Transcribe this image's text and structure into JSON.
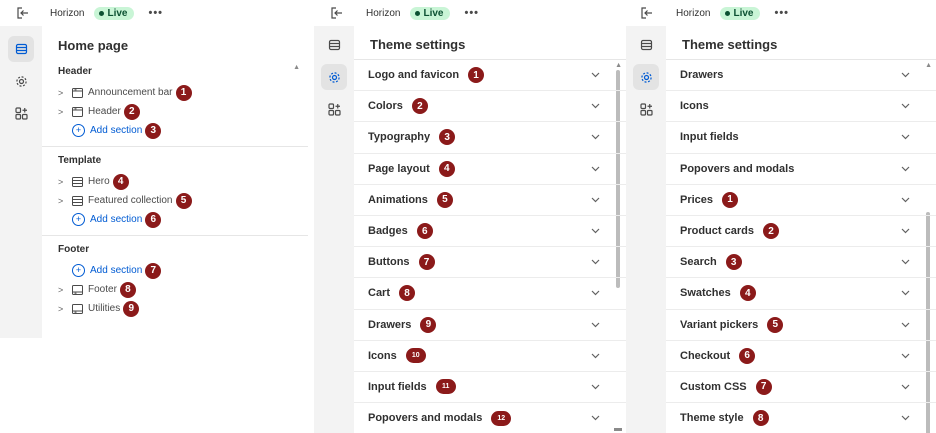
{
  "colors": {
    "live_bg": "#c9f5d6",
    "live_text": "#0c5132",
    "badge": "#8b1a1a",
    "link": "#005bd3"
  },
  "topbar": {
    "app_name": "Horizon",
    "status": "Live",
    "more": "•••"
  },
  "panel1": {
    "title": "Home page",
    "groups": [
      {
        "title": "Header",
        "items": [
          {
            "label": "Announcement bar",
            "icon": "section-icon",
            "badge": "1"
          },
          {
            "label": "Header",
            "icon": "section-icon",
            "badge": "2"
          }
        ],
        "add": {
          "label": "Add section",
          "badge": "3"
        }
      },
      {
        "title": "Template",
        "items": [
          {
            "label": "Hero",
            "icon": "section-icon",
            "badge": "4"
          },
          {
            "label": "Featured collection",
            "icon": "section-icon",
            "badge": "5"
          }
        ],
        "add": {
          "label": "Add section",
          "badge": "6"
        }
      },
      {
        "title": "Footer",
        "add": {
          "label": "Add section",
          "badge": "7"
        },
        "items": [
          {
            "label": "Footer",
            "icon": "section-icon",
            "badge": "8"
          },
          {
            "label": "Utilities",
            "icon": "section-icon",
            "badge": "9"
          }
        ]
      }
    ]
  },
  "panel2": {
    "title": "Theme settings",
    "items": [
      {
        "label": "Logo and favicon",
        "badge": "1"
      },
      {
        "label": "Colors",
        "badge": "2"
      },
      {
        "label": "Typography",
        "badge": "3"
      },
      {
        "label": "Page layout",
        "badge": "4"
      },
      {
        "label": "Animations",
        "badge": "5"
      },
      {
        "label": "Badges",
        "badge": "6"
      },
      {
        "label": "Buttons",
        "badge": "7"
      },
      {
        "label": "Cart",
        "badge": "8"
      },
      {
        "label": "Drawers",
        "badge": "9"
      },
      {
        "label": "Icons",
        "badge": "10"
      },
      {
        "label": "Input fields",
        "badge": "11"
      },
      {
        "label": "Popovers and modals",
        "badge": "12"
      }
    ]
  },
  "panel3": {
    "title": "Theme settings",
    "items": [
      {
        "label": "Drawers"
      },
      {
        "label": "Icons"
      },
      {
        "label": "Input fields"
      },
      {
        "label": "Popovers and modals"
      },
      {
        "label": "Prices",
        "badge": "1"
      },
      {
        "label": "Product cards",
        "badge": "2"
      },
      {
        "label": "Search",
        "badge": "3"
      },
      {
        "label": "Swatches",
        "badge": "4"
      },
      {
        "label": "Variant pickers",
        "badge": "5"
      },
      {
        "label": "Checkout",
        "badge": "6"
      },
      {
        "label": "Custom CSS",
        "badge": "7"
      },
      {
        "label": "Theme style",
        "badge": "8"
      }
    ]
  }
}
